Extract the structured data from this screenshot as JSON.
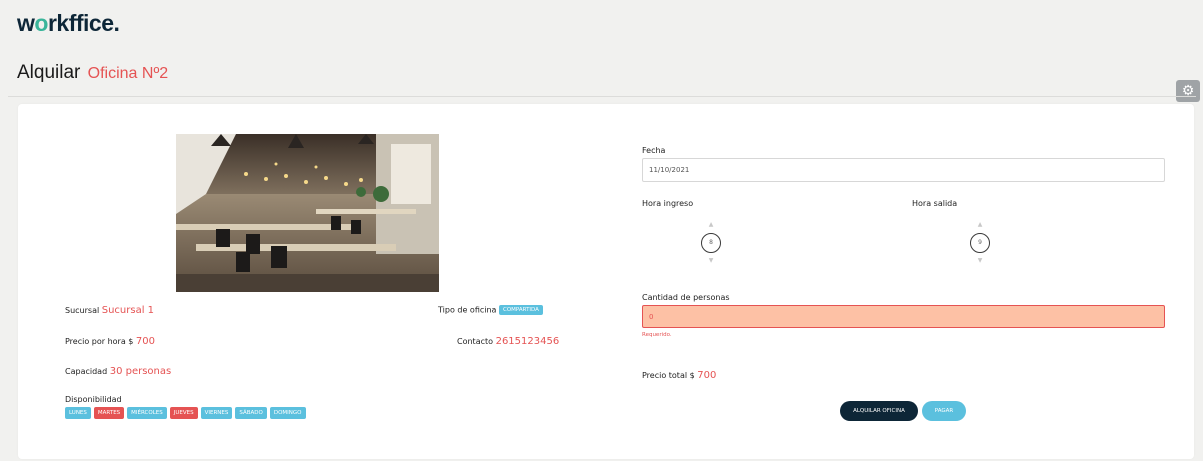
{
  "brand": {
    "logo_pre": "w",
    "logo_dot": "o",
    "logo_post": "rkffice."
  },
  "header": {
    "title": "Alquilar",
    "subtitle": "Oficina Nº2"
  },
  "office": {
    "sucursal_label": "Sucursal",
    "sucursal_value": "Sucursal 1",
    "tipo_label": "Tipo de oficina",
    "tipo_value": "COMPARTIDA",
    "precio_label": "Precio por hora $",
    "precio_value": "700",
    "contacto_label": "Contacto",
    "contacto_value": "2615123456",
    "capacidad_label": "Capacidad",
    "capacidad_value": "30 personas",
    "disponibilidad_label": "Disponibilidad",
    "days": [
      {
        "label": "LUNES",
        "color": "#5bc0de"
      },
      {
        "label": "MARTES",
        "color": "#e55353"
      },
      {
        "label": "MIÉRCOLES",
        "color": "#5bc0de"
      },
      {
        "label": "JUEVES",
        "color": "#e55353"
      },
      {
        "label": "VIERNES",
        "color": "#5bc0de"
      },
      {
        "label": "SÁBADO",
        "color": "#5bc0de"
      },
      {
        "label": "DOMINGO",
        "color": "#5bc0de"
      }
    ]
  },
  "form": {
    "fecha_label": "Fecha",
    "fecha_value": "11/10/2021",
    "hora_ingreso_label": "Hora ingreso",
    "hora_ingreso_value": "8",
    "hora_salida_label": "Hora salida",
    "hora_salida_value": "9",
    "cantidad_label": "Cantidad de personas",
    "cantidad_value": "0",
    "cantidad_error": "Requerido.",
    "total_label": "Precio total $",
    "total_value": "700",
    "alquilar_button": "ALQUILAR OFICINA",
    "pagar_button": "PAGAR"
  },
  "icons": {
    "settings": "gear-icon"
  },
  "colors": {
    "accent": "#e55353",
    "brand": "#0d2637",
    "info": "#5bc0de"
  }
}
